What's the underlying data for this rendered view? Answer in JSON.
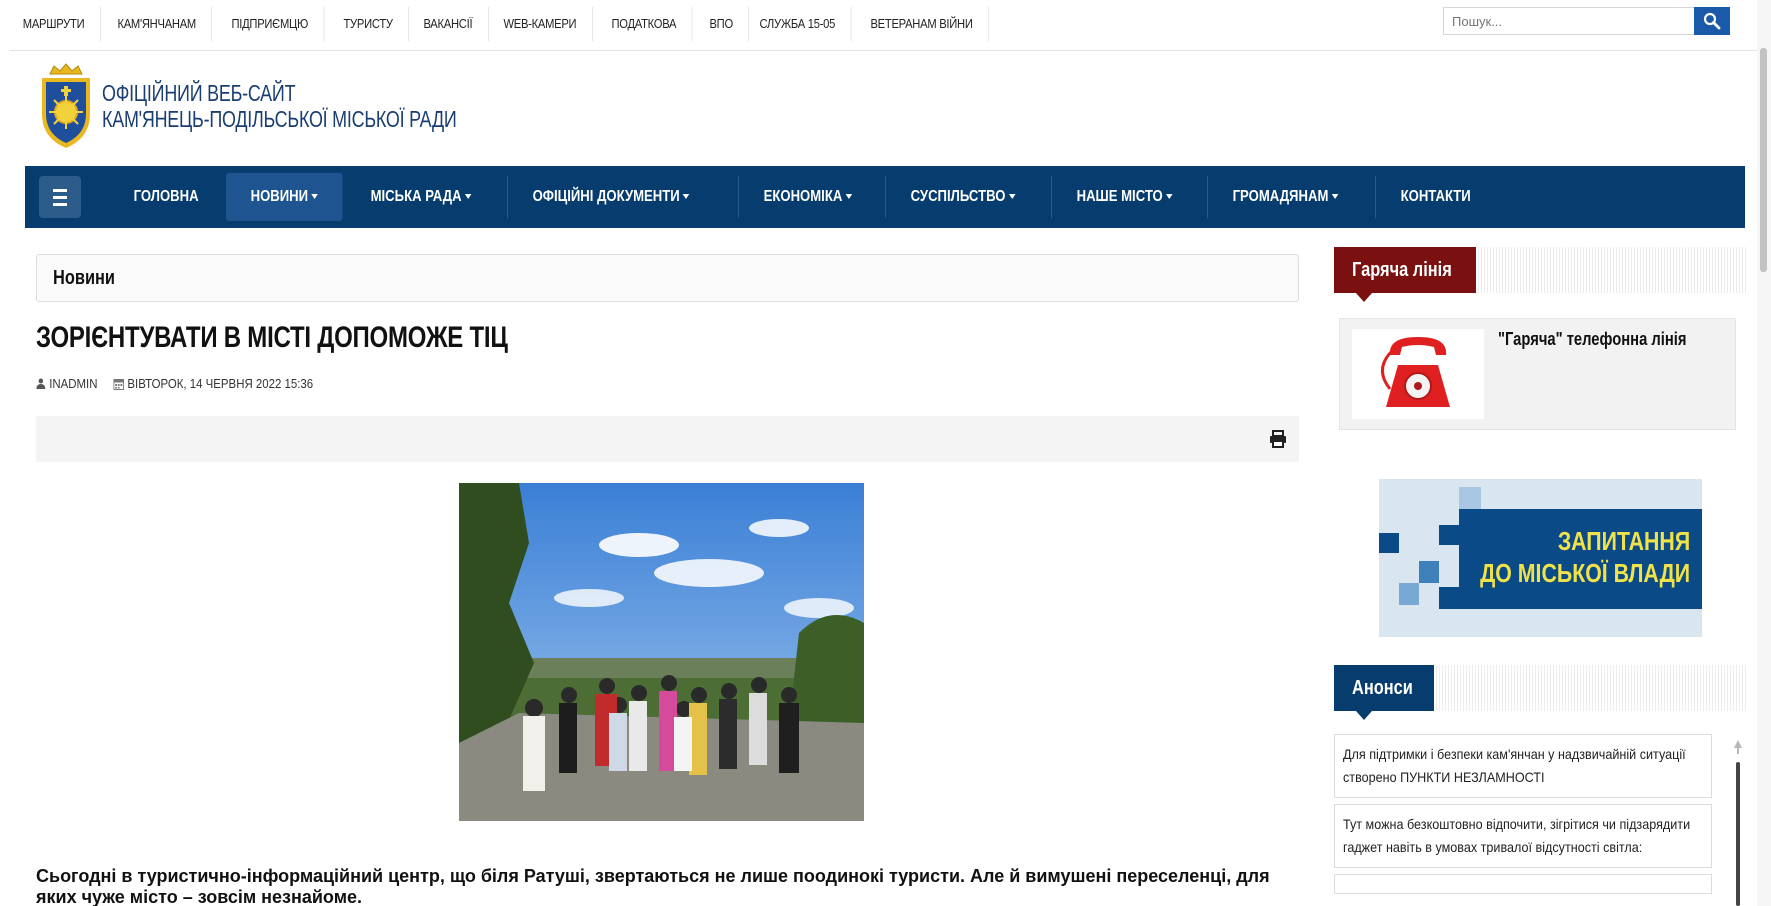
{
  "topnav": {
    "items": [
      "МАРШРУТИ",
      "КАМ'ЯНЧАНАМ",
      "ПІДПРИЄМЦЮ",
      "ТУРИСТУ",
      "ВАКАНСІЇ",
      "WEB-КАМЕРИ",
      "ПОДАТКОВА",
      "ВПО",
      "СЛУЖБА 15-05",
      "ВЕТЕРАНАМ ВІЙНИ"
    ],
    "search_placeholder": "Пошук..."
  },
  "header": {
    "title_line1": "ОФІЦІЙНИЙ ВЕБ-САЙТ",
    "title_line2": "КАМ'ЯНЕЦЬ-ПОДІЛЬСЬКОЇ МІСЬКОЇ РАДИ"
  },
  "mainnav": {
    "items": [
      {
        "label": "ГОЛОВНА",
        "dropdown": false,
        "active": false
      },
      {
        "label": "НОВИНИ",
        "dropdown": true,
        "active": true
      },
      {
        "label": "МІСЬКА РАДА",
        "dropdown": true,
        "active": false
      },
      {
        "label": "ОФІЦІЙНІ ДОКУМЕНТИ",
        "dropdown": true,
        "active": false
      },
      {
        "label": "ЕКОНОМІКА",
        "dropdown": true,
        "active": false
      },
      {
        "label": "СУСПІЛЬСТВО",
        "dropdown": true,
        "active": false
      },
      {
        "label": "НАШЕ МІСТО",
        "dropdown": true,
        "active": false
      },
      {
        "label": "ГРОМАДЯНАМ",
        "dropdown": true,
        "active": false
      },
      {
        "label": "КОНТАКТИ",
        "dropdown": false,
        "active": false
      }
    ]
  },
  "article": {
    "category": "Новини",
    "title": "ЗОРІЄНТУВАТИ В МІСТІ ДОПОМОЖЕ ТІЦ",
    "author": "INADMIN",
    "date": "ВІВТОРОК, 14 ЧЕРВНЯ 2022 15:36",
    "lead": "Сьогодні в туристично-інформаційний центр, що біля Ратуші, звертаються не лише поодинокі туристи. Але й вимушені переселенці, для яких чуже місто – зовсім незнайоме."
  },
  "sidebar": {
    "hotline_header": "Гаряча лінія",
    "hotline_text": "\"Гаряча\" телефонна лінія",
    "banner_line1": "ЗАПИТАННЯ",
    "banner_line2": "ДО МІСЬКОЇ ВЛАДИ",
    "announcements_header": "Анонси",
    "announcements": [
      "Для підтримки і безпеки кам'янчан у надзвичайній ситуації створено ПУНКТИ НЕЗЛАМНОСТІ",
      "Тут можна безкоштовно відпочити, зігрітися чи підзарядити гаджет навіть в умовах тривалої відсутності світла:"
    ]
  },
  "colors": {
    "nav_bg": "#063d6e",
    "nav_active": "#1e5590",
    "hotline_red": "#7a1010",
    "search_button": "#1a5aa8",
    "banner_yellow": "#f2e24a"
  },
  "icons": {
    "search": "search-icon",
    "menu": "hamburger-icon",
    "user": "user-icon",
    "calendar": "calendar-icon",
    "print": "print-icon",
    "phone": "red-telephone-icon"
  }
}
